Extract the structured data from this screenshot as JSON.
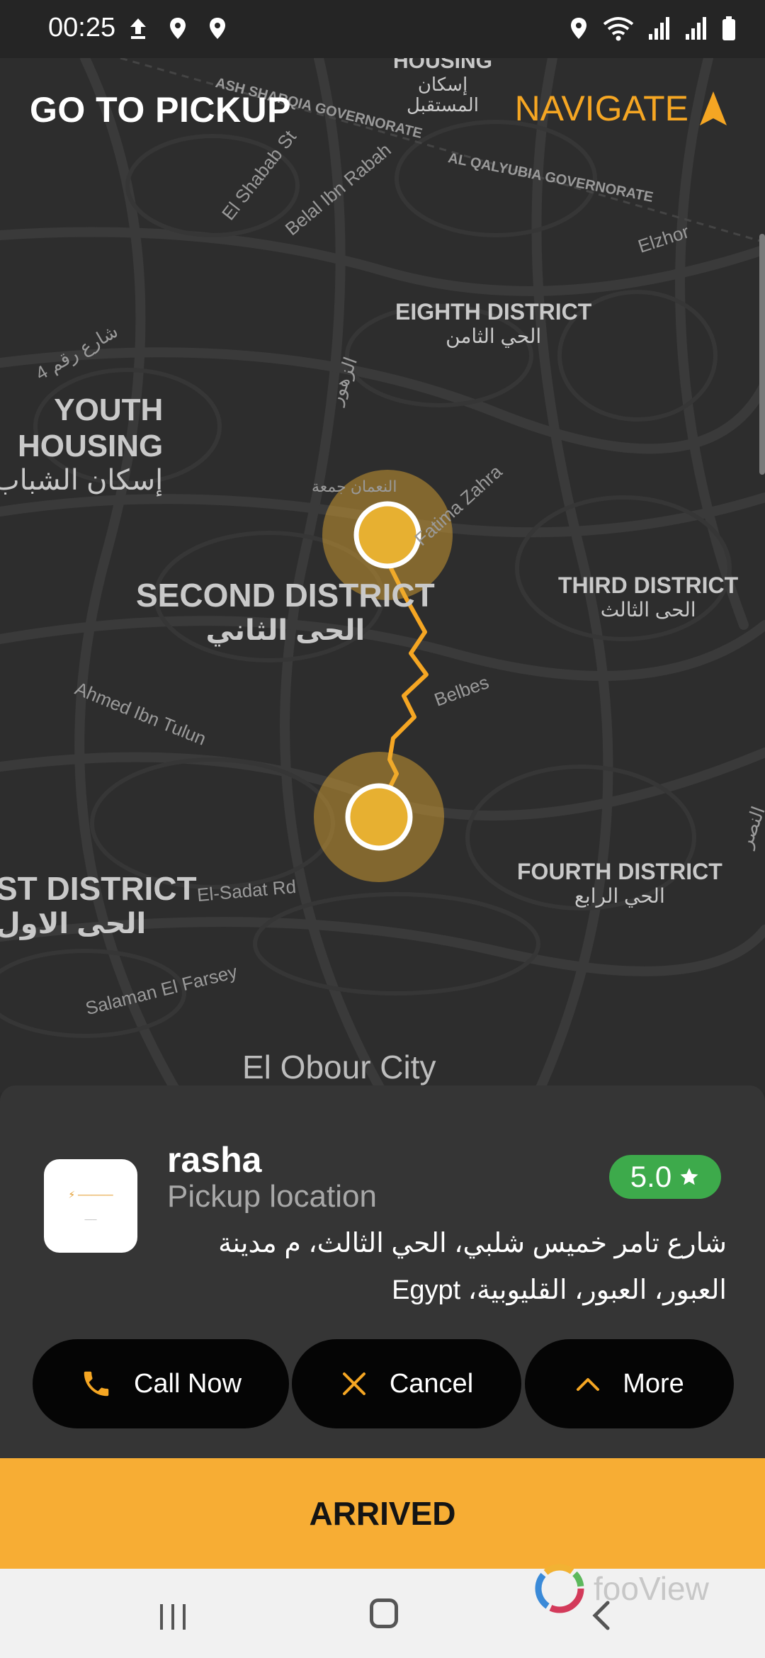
{
  "status_bar": {
    "time": "00:25",
    "left_icons": [
      "upload-icon",
      "location-pin-icon",
      "location-pin-icon"
    ],
    "right_icons": [
      "location-pin-icon",
      "wifi-icon",
      "signal-icon",
      "signal-icon",
      "battery-icon"
    ]
  },
  "header": {
    "title": "GO TO PICKUP",
    "navigate_label": "NAVIGATE",
    "accent_color": "#f5a623"
  },
  "map": {
    "labels": [
      {
        "en": "HOUSING",
        "ar": "إسكان\nالمستقبل"
      },
      {
        "en": "EIGHTH DISTRICT",
        "ar": "الحي الثامن"
      },
      {
        "en": "YOUTH\nHOUSING",
        "ar": "إسكان الشباب"
      },
      {
        "en": "SECOND DISTRICT",
        "ar": "الحى الثاني"
      },
      {
        "en": "THIRD DISTRICT",
        "ar": "الحى الثالث"
      },
      {
        "en": "FOURTH DISTRICT",
        "ar": "الحي الرابع"
      },
      {
        "en": "ST DISTRICT",
        "ar": "الحى الاول"
      },
      {
        "en": "El Obour City",
        "ar": ""
      }
    ],
    "roads": [
      "ASH SHARQIA GOVERNORATE",
      "AL QALYUBIA GOVERNORATE",
      "El Shabab St",
      "Belal Ibn Rabah",
      "Elzhor",
      "Fatima Zahra",
      "Belbes",
      "Ahmed Ibn Tulun",
      "El-Sadat Rd",
      "Salaman El Farsey",
      "الزهور",
      "شارع رقم 4",
      "النصر",
      "النعمان جمعة"
    ]
  },
  "rider": {
    "name": "rasha",
    "pickup_label": "Pickup location",
    "address": "شارع تامر خميس شلبي، الحي الثالث، م مدينة العبور، العبور، القليوبية، Egypt",
    "rating": "5.0",
    "rating_icon": "star-icon",
    "rating_color": "#3daa4b"
  },
  "actions": {
    "call_label": "Call Now",
    "cancel_label": "Cancel",
    "more_label": "More"
  },
  "arrived_label": "ARRIVED",
  "watermark": "fooView"
}
